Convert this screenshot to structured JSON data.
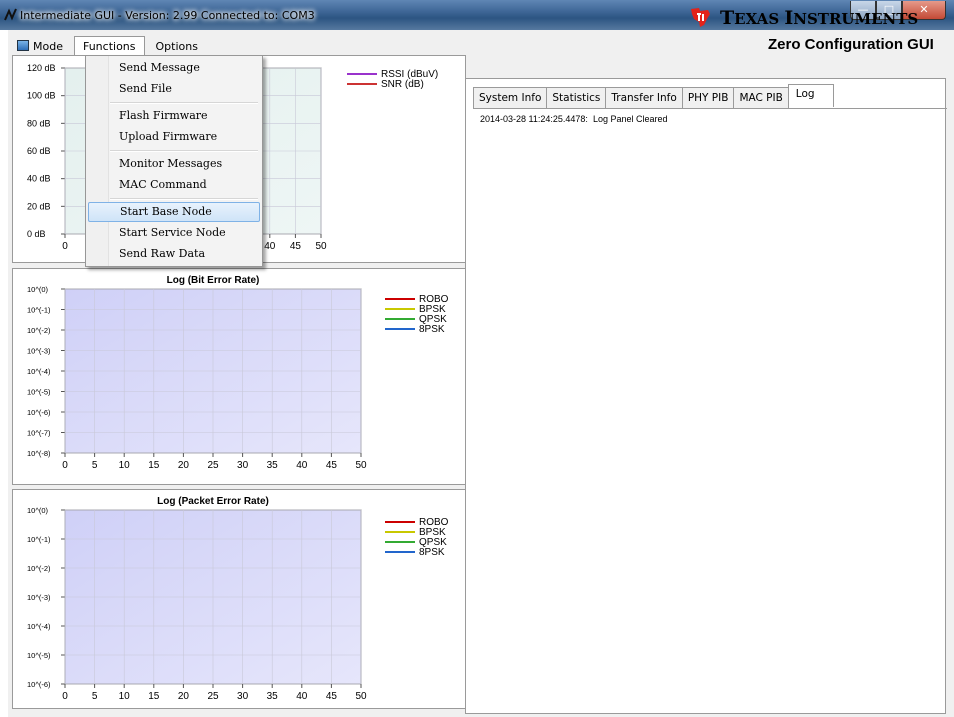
{
  "window": {
    "title": "Intermediate GUI - Version: 2.99    Connected to: COM3",
    "app_icon": "signal-icon",
    "buttons": {
      "minimize": "—",
      "maximize": "□",
      "close": "✕"
    }
  },
  "menubar": {
    "mode": "Mode",
    "functions": "Functions",
    "options": "Options"
  },
  "functions_menu": {
    "items": [
      "Send Message",
      "Send File",
      "Flash Firmware",
      "Upload Firmware",
      "Monitor Messages",
      "MAC Command",
      "Start Base Node",
      "Start Service Node",
      "Send Raw Data"
    ],
    "highlighted": "Start Base Node"
  },
  "branding": {
    "company": "Texas Instruments",
    "company_first": "T",
    "company_rest1": "EXAS ",
    "company_second": "I",
    "company_rest2": "NSTRUMENTS",
    "product": "Zero Configuration GUI",
    "logo_color": "#e2231a"
  },
  "tabs": [
    "System Info",
    "Statistics",
    "Transfer Info",
    "PHY PIB",
    "MAC PIB",
    "Log"
  ],
  "active_tab": "Log",
  "log": {
    "entries": [
      {
        "timestamp": "2014-03-28 11:24:25.4478:",
        "message": "Log Panel Cleared"
      }
    ]
  },
  "chart_data": [
    {
      "type": "line",
      "title": "",
      "y_ticks": [
        "120 dB",
        "100 dB",
        "80 dB",
        "60 dB",
        "40 dB",
        "20 dB",
        "0 dB"
      ],
      "x_ticks": [
        "0",
        "40",
        "45",
        "50"
      ],
      "ylim": [
        0,
        120
      ],
      "xlim": [
        0,
        50
      ],
      "grid": true,
      "legend_placement": "top-right",
      "series": [
        {
          "name": "RSSI (dBuV)",
          "color": "#9933cc",
          "values": []
        },
        {
          "name": "SNR (dB)",
          "color": "#cc3333",
          "values": []
        }
      ]
    },
    {
      "type": "line",
      "title": "Log (Bit Error Rate)",
      "y_ticks": [
        "10^(0)",
        "10^(-1)",
        "10^(-2)",
        "10^(-3)",
        "10^(-4)",
        "10^(-5)",
        "10^(-6)",
        "10^(-7)",
        "10^(-8)"
      ],
      "x_ticks": [
        "0",
        "5",
        "10",
        "15",
        "20",
        "25",
        "30",
        "35",
        "40",
        "45",
        "50"
      ],
      "xlim": [
        0,
        50
      ],
      "grid": true,
      "legend_placement": "top-right",
      "series": [
        {
          "name": "ROBO",
          "color": "#cc0000",
          "values": []
        },
        {
          "name": "BPSK",
          "color": "#c8c800",
          "values": []
        },
        {
          "name": "QPSK",
          "color": "#33aa33",
          "values": []
        },
        {
          "name": "8PSK",
          "color": "#2266cc",
          "values": []
        }
      ]
    },
    {
      "type": "line",
      "title": "Log (Packet Error Rate)",
      "y_ticks": [
        "10^(0)",
        "10^(-1)",
        "10^(-2)",
        "10^(-3)",
        "10^(-4)",
        "10^(-5)",
        "10^(-6)"
      ],
      "x_ticks": [
        "0",
        "5",
        "10",
        "15",
        "20",
        "25",
        "30",
        "35",
        "40",
        "45",
        "50"
      ],
      "xlim": [
        0,
        50
      ],
      "grid": true,
      "legend_placement": "top-right",
      "series": [
        {
          "name": "ROBO",
          "color": "#cc0000",
          "values": []
        },
        {
          "name": "BPSK",
          "color": "#c8c800",
          "values": []
        },
        {
          "name": "QPSK",
          "color": "#33aa33",
          "values": []
        },
        {
          "name": "8PSK",
          "color": "#2266cc",
          "values": []
        }
      ]
    }
  ]
}
